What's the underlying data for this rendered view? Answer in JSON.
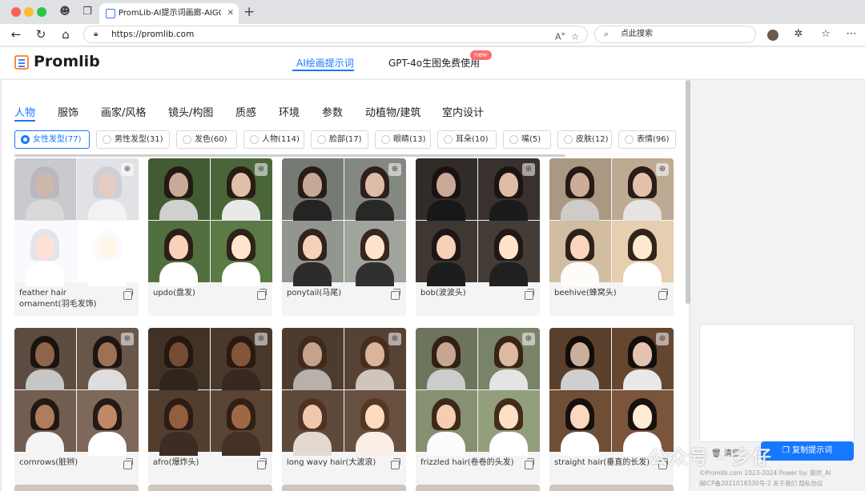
{
  "browser": {
    "tab_title": "PromLib-AI提示词画廊-AIGC提示",
    "url": "https://promlib.com",
    "search_placeholder": "点此搜索"
  },
  "header": {
    "logo_text": "Promlib",
    "nav": [
      {
        "label": "AI绘画提示词",
        "active": true
      },
      {
        "label": "GPT-4o生图免费使用",
        "active": false
      }
    ],
    "new_badge": "new"
  },
  "categories": [
    "人物",
    "服饰",
    "画家/风格",
    "镜头/构图",
    "质感",
    "环境",
    "参数",
    "动植物/建筑",
    "室内设计"
  ],
  "subcategories": [
    {
      "label": "女性发型(77)",
      "active": true
    },
    {
      "label": "男性发型(31)",
      "active": false
    },
    {
      "label": "发色(60)",
      "active": false
    },
    {
      "label": "人物(114)",
      "active": false
    },
    {
      "label": "脸部(17)",
      "active": false
    },
    {
      "label": "眼睛(13)",
      "active": false
    },
    {
      "label": "耳朵(10)",
      "active": false
    },
    {
      "label": "嘴(5)",
      "active": false
    },
    {
      "label": "皮肤(12)",
      "active": false
    },
    {
      "label": "表情(96)",
      "active": false
    }
  ],
  "cards": [
    {
      "caption": "feather hair ornament(羽毛发饰)",
      "hair": "#d9d9df",
      "bg": "#eceef2",
      "skin": "#f0d7cc",
      "cloth": "#ffffff"
    },
    {
      "caption": "updo(盘发)",
      "hair": "#2a1d16",
      "bg": "#4e6b3c",
      "skin": "#edc8b2",
      "cloth": "#f5f5f5"
    },
    {
      "caption": "ponytail(马尾)",
      "hair": "#2f211a",
      "bg": "#8a8f88",
      "skin": "#e9c6b1",
      "cloth": "#2a2a2a"
    },
    {
      "caption": "bob(波波头)",
      "hair": "#1d1513",
      "bg": "#3b3430",
      "skin": "#ebc6b0",
      "cloth": "#1c1c1c"
    },
    {
      "caption": "beehive(蜂窝头)",
      "hair": "#2b1f18",
      "bg": "#c8b39a",
      "skin": "#efcbb5",
      "cloth": "#f2f0ec"
    },
    {
      "caption": "cornrows(脏辫)",
      "hair": "#1f1612",
      "bg": "#6d5a4d",
      "skin": "#a77758",
      "cloth": "#e9e9e9"
    },
    {
      "caption": "afro(爆炸头)",
      "hair": "#2a1b12",
      "bg": "#4d3b2d",
      "skin": "#8a5a3c",
      "cloth": "#3a2a22"
    },
    {
      "caption": "long wavy hair(大波浪)",
      "hair": "#4a3020",
      "bg": "#5a4638",
      "skin": "#e6bea4",
      "cloth": "#d9cfc7"
    },
    {
      "caption": "frizzled hair(卷卷的头发)",
      "hair": "#3a2618",
      "bg": "#7f8a6c",
      "skin": "#e9c3aa",
      "cloth": "#f0f0f0"
    },
    {
      "caption": "straight hair(垂直的长发)",
      "hair": "#140f0d",
      "bg": "#6a4a33",
      "skin": "#efcdb8",
      "cloth": "#f4f4f4"
    }
  ],
  "panel": {
    "clear_label": "清空",
    "copy_label": "复制提示词",
    "footer": [
      "©Promlib.com 2023-2024   Power by: 莫然_AI",
      "闽ICP备2021018330号-2  关于我们  隐私协议"
    ]
  },
  "watermark": "公众号 · 乡仔"
}
